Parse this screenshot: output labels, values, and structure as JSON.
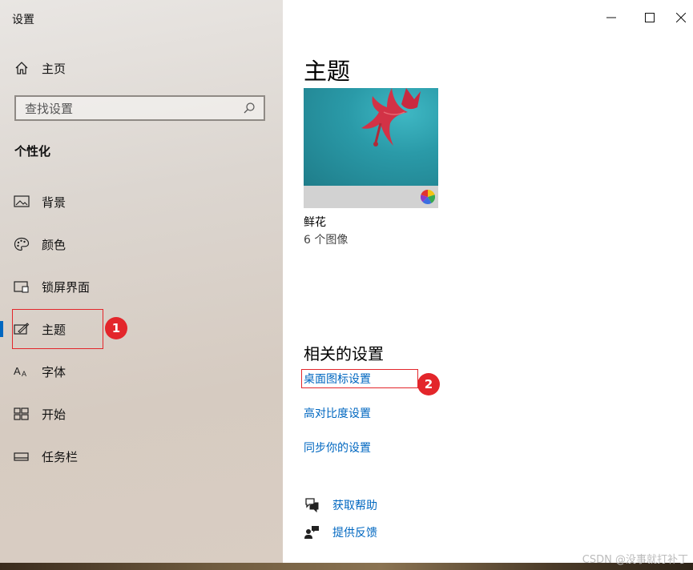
{
  "app_title": "设置",
  "sidebar": {
    "home_label": "主页",
    "search_placeholder": "查找设置",
    "section_title": "个性化",
    "items": [
      {
        "label": "背景"
      },
      {
        "label": "颜色"
      },
      {
        "label": "锁屏界面"
      },
      {
        "label": "主题"
      },
      {
        "label": "字体"
      },
      {
        "label": "开始"
      },
      {
        "label": "任务栏"
      }
    ],
    "selected_index": 3
  },
  "annotations": [
    {
      "number": "1"
    },
    {
      "number": "2"
    }
  ],
  "main": {
    "page_title": "主题",
    "theme": {
      "name": "鲜花",
      "count": "6 个图像"
    },
    "related_title": "相关的设置",
    "links": [
      "桌面图标设置",
      "高对比度设置",
      "同步你的设置"
    ],
    "help": [
      "获取帮助",
      "提供反馈"
    ]
  },
  "watermark": "CSDN @没事就打补丁",
  "colors": {
    "accent": "#0067c0",
    "annotation_red": "#e3262b"
  },
  "icons": [
    "home-icon",
    "search-icon",
    "picture-icon",
    "palette-icon",
    "lock-screen-icon",
    "theme-brush-icon",
    "font-icon",
    "start-grid-icon",
    "taskbar-icon",
    "help-chat-icon",
    "feedback-icon",
    "minimize-icon",
    "maximize-icon",
    "close-icon"
  ]
}
